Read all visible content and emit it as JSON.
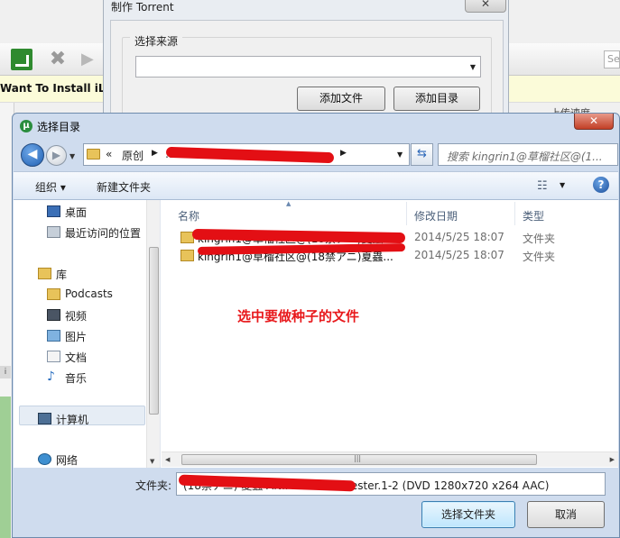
{
  "background": {
    "banner_text": "Want To Install iLi",
    "search_placeholder": "Se",
    "header_text_1": "…",
    "header_text_2": "上传速度"
  },
  "torrent_dialog": {
    "title": "制作 Torrent",
    "close_label": "✕",
    "source_group_label": "选择来源",
    "source_value": "",
    "add_file_label": "添加文件",
    "add_dir_label": "添加目录"
  },
  "folder_dialog": {
    "title": "选择目录",
    "close_label": "✕",
    "address": {
      "chevron": "«",
      "part1": "原创",
      "part2": "…"
    },
    "search_placeholder": "搜索 kingrin1@草榴社区@(1...",
    "toolbar": {
      "organize_label": "组织 ▾",
      "new_folder_label": "新建文件夹"
    },
    "nav_items": [
      {
        "label": "桌面"
      },
      {
        "label": "最近访问的位置"
      },
      {
        "label": "库"
      },
      {
        "label": "Podcasts"
      },
      {
        "label": "视频"
      },
      {
        "label": "图片"
      },
      {
        "label": "文档"
      },
      {
        "label": "音乐"
      },
      {
        "label": "计算机"
      },
      {
        "label": "网络"
      }
    ],
    "columns": {
      "name": "名称",
      "date": "修改日期",
      "type": "类型"
    },
    "files": [
      {
        "name": "kingrin1@草榴社区@(18禁アニ)夏蟲...",
        "date": "2014/5/25 18:07",
        "type": "文件夹"
      },
      {
        "name": "kingrin1@草榴社区@(18禁アニ)夏蟲...",
        "date": "2014/5/25 18:07",
        "type": "文件夹"
      }
    ],
    "annotation": "选中要做种子的文件",
    "folder_label": "文件夹:",
    "folder_value": "(18禁アニ) 夏蟲 ANIMATION molester.1-2  (DVD 1280x720 x264 AAC)",
    "select_label": "选择文件夹",
    "cancel_label": "取消"
  }
}
